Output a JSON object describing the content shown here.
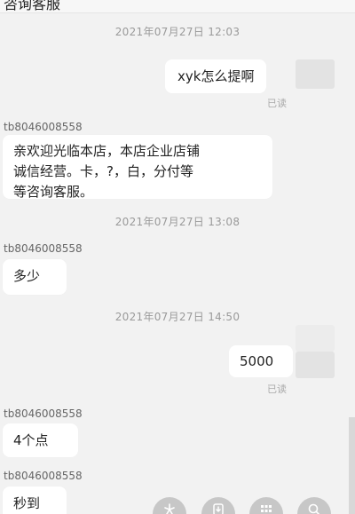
{
  "header": {
    "title": "咨询客服"
  },
  "messages": [
    {
      "type": "time",
      "text": "2021年07月27日 12:03"
    },
    {
      "type": "out",
      "text": "xyk怎么提啊",
      "status": "已读"
    },
    {
      "type": "in",
      "sender": "tb8046008558",
      "lines": [
        "亲欢迎光临本店，本店企业店铺",
        "诚信经营。卡，?，白，分付等",
        "等咨询客服。"
      ]
    },
    {
      "type": "time",
      "text": "2021年07月27日 13:08"
    },
    {
      "type": "in",
      "sender": "tb8046008558",
      "text": "多少"
    },
    {
      "type": "time",
      "text": "2021年07月27日 14:50"
    },
    {
      "type": "out",
      "text": "5000",
      "status": "已读"
    },
    {
      "type": "in",
      "sender": "tb8046008558",
      "text": "4个点"
    },
    {
      "type": "in",
      "sender": "tb8046008558",
      "text": "秒到"
    }
  ],
  "bottom_actions": [
    {
      "icon": "flower-icon"
    },
    {
      "icon": "download-icon"
    },
    {
      "icon": "grid-icon"
    },
    {
      "icon": "search-icon"
    }
  ]
}
